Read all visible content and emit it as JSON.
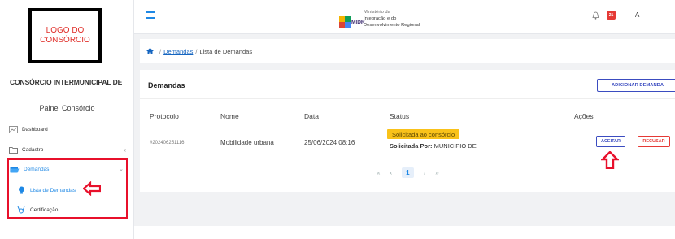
{
  "sidebar": {
    "logo_text": "LOGO DO\nCONSÓRCIO",
    "org_name": "CONSÓRCIO INTERMUNICIPAL DE",
    "panel_title": "Painel Consórcio",
    "items": [
      {
        "label": "Dashboard",
        "icon": "chart-line-icon"
      },
      {
        "label": "Cadastro",
        "icon": "folder-icon"
      },
      {
        "label": "Demandas",
        "icon": "folder-open-icon",
        "active": true
      }
    ],
    "subitems": [
      {
        "label": "Lista de Demandas",
        "icon": "lightbulb-icon"
      },
      {
        "label": "Certificação",
        "icon": "certificate-icon"
      }
    ]
  },
  "header": {
    "brand_word": "MIDR",
    "ministry_line1": "Ministério da",
    "ministry_line2": "Integração e do",
    "ministry_line3": "Desenvolvimento Regional",
    "notification_count": "21",
    "user_initial": "A"
  },
  "breadcrumb": {
    "home_separator": "/",
    "link": "Demandas",
    "separator": "/",
    "current": "Lista de Demandas"
  },
  "card": {
    "title": "Demandas",
    "add_button": "ADICIONAR DEMANDA",
    "columns": [
      "Protocolo",
      "Nome",
      "Data",
      "Status",
      "Ações"
    ],
    "rows": [
      {
        "protocolo": "#202406251116",
        "nome": "Mobilidade urbana",
        "data": "25/06/2024 08:16",
        "status": "Solicitada ao consórcio",
        "solicitada_label": "Solicitada Por:",
        "solicitada_value": "MUNICIPIO DE",
        "accept": "ACEITAR",
        "refuse": "RECUSAR"
      }
    ],
    "pager": {
      "first": "«",
      "prev": "‹",
      "page": "1",
      "next": "›",
      "last": "»"
    }
  },
  "colors": {
    "accent": "#1e88e5",
    "highlight": "#e8102b",
    "status_badge": "#f9c21a"
  }
}
